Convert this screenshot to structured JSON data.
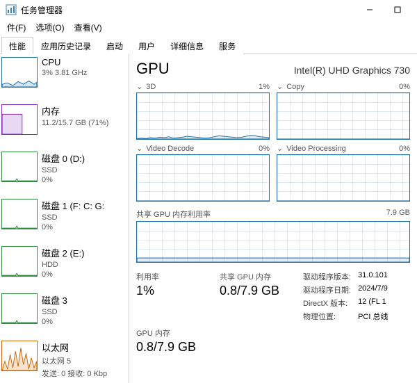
{
  "window": {
    "title": "任务管理器"
  },
  "menu": {
    "file": "件(F)",
    "options": "选项(O)",
    "view": "查看(V)"
  },
  "tabs": {
    "t0": "性能",
    "t1": "应用历史记录",
    "t2": "启动",
    "t3": "用户",
    "t4": "详细信息",
    "t5": "服务"
  },
  "sidebar": [
    {
      "title": "CPU",
      "sub": "3%  3.81 GHz",
      "color": "#1a6fb0"
    },
    {
      "title": "内存",
      "sub": "11.2/15.7 GB (71%)",
      "color": "#8a2fbf"
    },
    {
      "title": "磁盘 0 (D:)",
      "sub": "SSD",
      "sub2": "0%",
      "color": "#2f8f3f"
    },
    {
      "title": "磁盘 1 (F: C: G:",
      "sub": "SSD",
      "sub2": "0%",
      "color": "#2f8f3f"
    },
    {
      "title": "磁盘 2 (E:)",
      "sub": "HDD",
      "sub2": "0%",
      "color": "#2f8f3f"
    },
    {
      "title": "磁盘 3",
      "sub": "SSD",
      "sub2": "0%",
      "color": "#2f8f3f"
    },
    {
      "title": "以太网",
      "sub": "以太网 5",
      "sub2": "发送: 0  接收: 0 Kbp",
      "color": "#c86400"
    }
  ],
  "detail": {
    "title": "GPU",
    "subtitle": "Intel(R) UHD Graphics 730",
    "charts": [
      {
        "name": "3D",
        "pct": "1%"
      },
      {
        "name": "Copy",
        "pct": "0%"
      },
      {
        "name": "Video Decode",
        "pct": "0%"
      },
      {
        "name": "Video Processing",
        "pct": "0%"
      }
    ],
    "shared_mem_label": "共享 GPU 内存利用率",
    "shared_mem_max": "7.9 GB",
    "stats": {
      "util_label": "利用率",
      "util_value": "1%",
      "shared_label": "共享 GPU 内存",
      "shared_value": "0.8/7.9 GB",
      "gpu_mem_label": "GPU 内存",
      "gpu_mem_value": "0.8/7.9 GB"
    },
    "meta": {
      "driver_ver_label": "驱动程序版本:",
      "driver_ver": "31.0.101",
      "driver_date_label": "驱动程序日期:",
      "driver_date": "2024/7/9",
      "directx_label": "DirectX 版本:",
      "directx": "12 (FL 1",
      "loc_label": "物理位置:",
      "loc": "PCI 总线"
    }
  },
  "chart_data": [
    {
      "type": "area",
      "title": "3D",
      "ylim": [
        0,
        100
      ],
      "values": [
        1,
        2,
        1,
        3,
        2,
        4,
        3,
        5,
        2,
        3,
        4,
        6,
        5,
        4,
        3,
        2,
        3,
        5,
        7,
        6,
        5,
        4,
        3,
        4,
        6,
        8,
        7,
        5,
        4,
        3
      ]
    },
    {
      "type": "area",
      "title": "Copy",
      "ylim": [
        0,
        100
      ],
      "values": [
        0,
        0,
        0,
        0,
        0,
        0,
        0,
        0,
        0,
        0,
        0,
        0,
        0,
        0,
        0,
        0,
        0,
        0,
        0,
        0,
        0,
        0,
        0,
        0,
        0,
        0,
        0,
        0,
        0,
        0
      ]
    },
    {
      "type": "area",
      "title": "Video Decode",
      "ylim": [
        0,
        100
      ],
      "values": [
        0,
        0,
        0,
        0,
        0,
        0,
        0,
        0,
        0,
        0,
        0,
        0,
        0,
        0,
        0,
        0,
        0,
        0,
        0,
        0,
        0,
        0,
        0,
        0,
        0,
        0,
        0,
        0,
        0,
        0
      ]
    },
    {
      "type": "area",
      "title": "Video Processing",
      "ylim": [
        0,
        100
      ],
      "values": [
        0,
        0,
        0,
        0,
        0,
        0,
        0,
        0,
        0,
        0,
        0,
        0,
        0,
        0,
        0,
        0,
        0,
        0,
        0,
        0,
        0,
        0,
        0,
        0,
        0,
        0,
        0,
        0,
        0,
        0
      ]
    },
    {
      "type": "area",
      "title": "共享 GPU 内存利用率",
      "ylim": [
        0,
        7.9
      ],
      "ylabel": "GB",
      "values": [
        0.8,
        0.8,
        0.8,
        0.8,
        0.8,
        0.8,
        0.8,
        0.8,
        0.8,
        0.8,
        0.8,
        0.8,
        0.8,
        0.8,
        0.8,
        0.8,
        0.8,
        0.8,
        0.8,
        0.8,
        0.8,
        0.8,
        0.8,
        0.8,
        0.8,
        0.8,
        0.8,
        0.8,
        0.8,
        0.8
      ]
    }
  ]
}
